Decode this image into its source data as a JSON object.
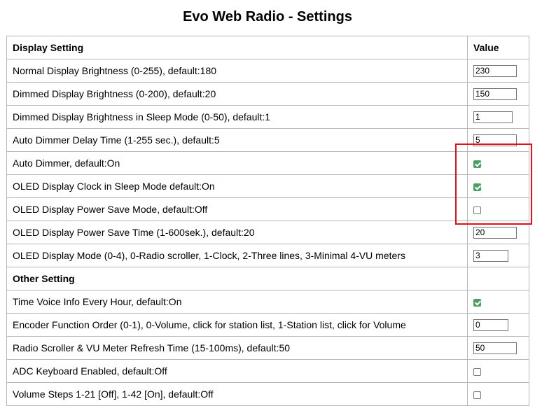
{
  "title": "Evo Web Radio - Settings",
  "table": {
    "header": {
      "setting": "Display Setting",
      "value": "Value"
    },
    "rows": [
      {
        "label": "Normal Display Brightness (0-255), default:180",
        "value": "230"
      },
      {
        "label": "Dimmed Display Brightness (0-200), default:20",
        "value": "150"
      },
      {
        "label": "Dimmed Display Brightness in Sleep Mode (0-50), default:1",
        "value": "1"
      },
      {
        "label": "Auto Dimmer Delay Time (1-255 sec.), default:5",
        "value": "5"
      },
      {
        "label": "Auto Dimmer, default:On",
        "checked": true
      },
      {
        "label": "OLED Display Clock in Sleep Mode default:On",
        "checked": true
      },
      {
        "label": "OLED Display Power Save Mode, default:Off",
        "checked": false
      },
      {
        "label": "OLED Display Power Save Time (1-600sek.), default:20",
        "value": "20"
      },
      {
        "label": "OLED Display Mode (0-4), 0-Radio scroller, 1-Clock, 2-Three lines, 3-Minimal 4-VU meters",
        "value": "3"
      }
    ],
    "section2": "Other Setting",
    "rows2": [
      {
        "label": "Time Voice Info Every Hour, default:On",
        "checked": true
      },
      {
        "label": "Encoder Function Order (0-1), 0-Volume, click for station list, 1-Station list, click for Volume",
        "value": "0"
      },
      {
        "label": "Radio Scroller & VU Meter Refresh Time (15-100ms), default:50",
        "value": "50"
      },
      {
        "label": "ADC Keyboard Enabled, default:Off",
        "checked": false
      },
      {
        "label": "Volume Steps 1-21 [Off], 1-42 [On], default:Off",
        "checked": false
      }
    ]
  },
  "colors": {
    "highlight_border": "#e1101a",
    "checkbox_checked": "#4f9e62",
    "table_border": "#b7b7b7"
  }
}
